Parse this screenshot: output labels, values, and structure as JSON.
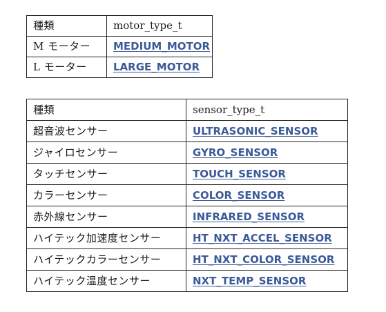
{
  "motor_table": {
    "header": {
      "kind": "種類",
      "type": "motor_type_t"
    },
    "rows": [
      {
        "label": "M モーター",
        "value": "MEDIUM_MOTOR"
      },
      {
        "label": "L モーター",
        "value": "LARGE_MOTOR"
      }
    ]
  },
  "sensor_table": {
    "header": {
      "kind": "種類",
      "type": "sensor_type_t"
    },
    "rows": [
      {
        "label": "超音波センサー",
        "value": "ULTRASONIC_SENSOR"
      },
      {
        "label": "ジャイロセンサー",
        "value": "GYRO_SENSOR"
      },
      {
        "label": "タッチセンサー",
        "value": "TOUCH_SENSOR"
      },
      {
        "label": "カラーセンサー",
        "value": "COLOR_SENSOR"
      },
      {
        "label": "赤外線センサー",
        "value": "INFRARED_SENSOR"
      },
      {
        "label": "ハイテック加速度センサー",
        "value": "HT_NXT_ACCEL_SENSOR"
      },
      {
        "label": "ハイテックカラーセンサー",
        "value": "HT_NXT_COLOR_SENSOR"
      },
      {
        "label": "ハイテック温度センサー",
        "value": "NXT_TEMP_SENSOR"
      }
    ]
  },
  "colors": {
    "link": "#3c5a98",
    "border": "#222222"
  }
}
